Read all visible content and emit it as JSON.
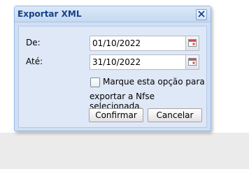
{
  "dialog": {
    "title": "Exportar XML",
    "close_icon": "close-icon"
  },
  "form": {
    "from_label": "De:",
    "from_value": "01/10/2022",
    "to_label": "Até:",
    "to_value": "31/10/2022",
    "date_trigger_icon": "calendar-icon",
    "checkbox_checked": false,
    "checkbox_label_line1": "Marque esta opção para",
    "checkbox_label_line2": "exportar a Nfse selecionada."
  },
  "buttons": {
    "confirm_label": "Confirmar",
    "cancel_label": "Cancelar"
  },
  "colors": {
    "title_text": "#15428b",
    "window_border": "#99bbe8",
    "body_background": "#dfe8f6",
    "close_x": "#15428b",
    "calendar_accent": "#c03030"
  }
}
